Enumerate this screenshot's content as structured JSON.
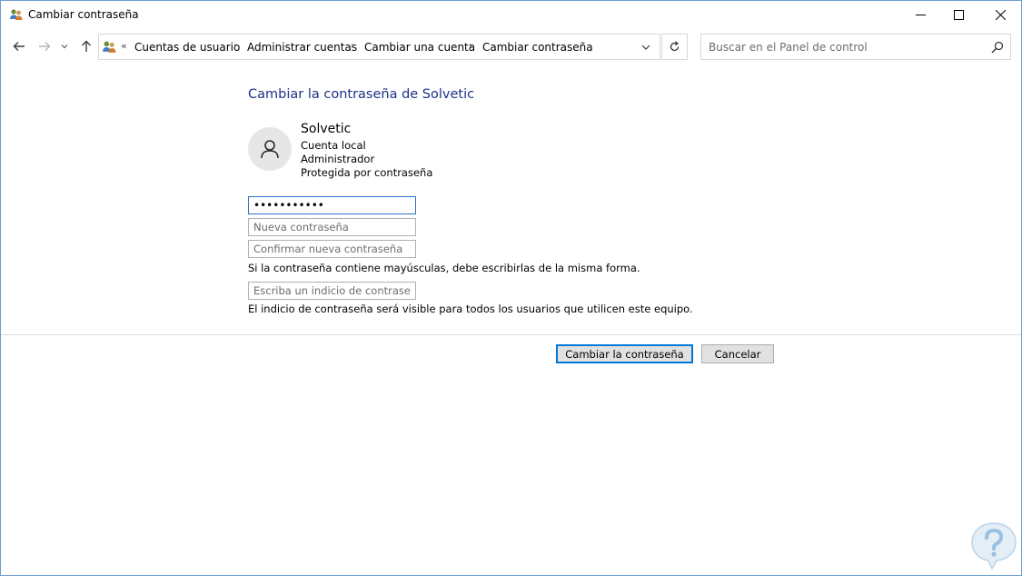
{
  "window": {
    "title": "Cambiar contraseña",
    "title_icon": "users-icon",
    "controls": [
      "minimize-icon",
      "maximize-icon",
      "close-icon"
    ]
  },
  "nav": {
    "back": "arrow-left-icon",
    "forward": "arrow-right-icon",
    "recent": "chevron-down-icon",
    "up": "arrow-up-icon"
  },
  "address": {
    "overflow": "«",
    "breadcrumbs": [
      "Cuentas de usuario",
      "Administrar cuentas",
      "Cambiar una cuenta",
      "Cambiar contraseña"
    ],
    "separator": "›"
  },
  "search": {
    "placeholder": "Buscar en el Panel de control"
  },
  "page": {
    "heading": "Cambiar la contraseña de Solvetic",
    "user": {
      "name": "Solvetic",
      "account_type": "Cuenta local",
      "role": "Administrador",
      "status": "Protegida por contraseña"
    },
    "form": {
      "current_password_value": "•••••••••••",
      "new_password_placeholder": "Nueva contraseña",
      "confirm_password_placeholder": "Confirmar nueva contraseña",
      "case_note": "Si la contraseña contiene mayúsculas, debe escribirlas de la misma forma.",
      "hint_placeholder": "Escriba un indicio de contraseña",
      "hint_note": "El indicio de contraseña será visible para todos los usuarios que utilicen este equipo."
    },
    "buttons": {
      "change": "Cambiar la contraseña",
      "cancel": "Cancelar"
    }
  },
  "colors": {
    "heading": "#1e3287",
    "accent": "#0078d7",
    "window_border": "#6f9fd0"
  }
}
